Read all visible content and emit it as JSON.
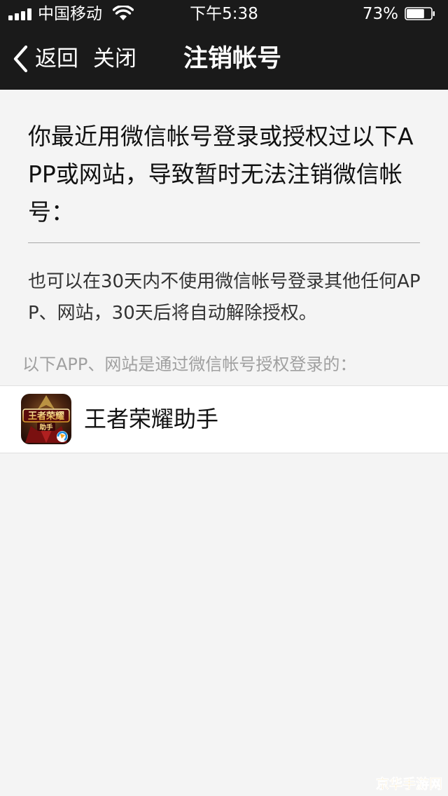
{
  "status_bar": {
    "carrier": "中国移动",
    "time": "下午5:38",
    "battery_percent": "73%",
    "battery_level": 0.73,
    "signal_icon": "signal-bars-icon",
    "wifi_icon": "wifi-icon"
  },
  "nav": {
    "back_label": "返回",
    "close_label": "关闭",
    "title": "注销帐号",
    "back_icon": "chevron-left-icon"
  },
  "content": {
    "main_message": "你最近用微信帐号登录或授权过以下APP或网站，导致暂时无法注销微信帐号：",
    "sub_message": "也可以在30天内不使用微信帐号登录其他任何APP、网站，30天后将自动解除授权。",
    "section_label": "以下APP、网站是通过微信帐号授权登录的："
  },
  "apps": [
    {
      "name": "王者荣耀助手",
      "icon": "honor-of-kings-assistant-app-icon",
      "icon_text": "王者荣耀 助手"
    }
  ],
  "watermark": {
    "text": "京华手游网",
    "color": "#e8a317"
  },
  "colors": {
    "header_bg": "#1a1a1a",
    "page_bg": "#f4f4f4",
    "section_label": "#a0a0a0"
  }
}
